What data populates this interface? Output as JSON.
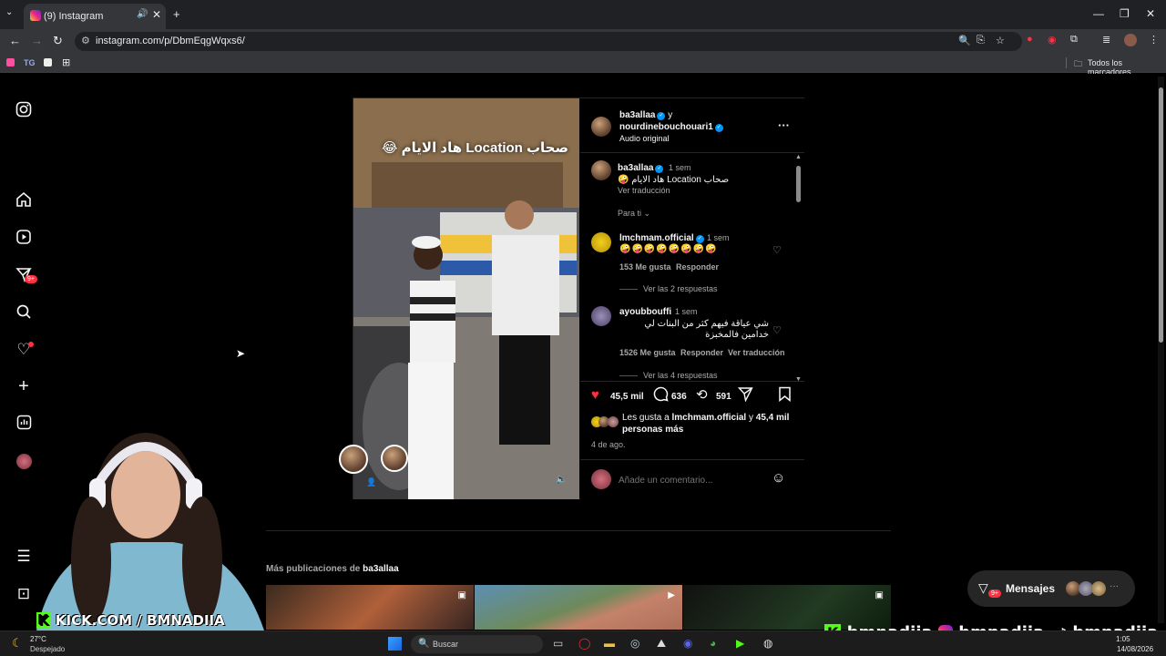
{
  "browser": {
    "tab_title": "(9) Instagram",
    "url": "instagram.com/p/DbmEqgWqxs6/",
    "bookmark_tg": "TG",
    "all_bookmarks": "Todos los marcadores"
  },
  "post": {
    "video_caption_overlay": "صحاب Location هاد الايام 😂",
    "header_user1": "ba3allaa",
    "header_and": "y",
    "header_user2": "nourdinebouchouari1",
    "header_audio": "Audio original",
    "caption_user": "ba3allaa",
    "caption_time": "1 sem",
    "caption_text": "صحاب Location هاد الايام 🤪",
    "see_translation": "Ver traducción",
    "for_you": "Para ti",
    "comments": [
      {
        "user": "lmchmam.official",
        "time": "1 sem",
        "text": "🤪🤪🤪🤪🤪🤪🤪🤪",
        "likes": "153 Me gusta",
        "reply": "Responder",
        "translate": "",
        "view_replies": "Ver las 2 respuestas"
      },
      {
        "user": "ayoubbouffi",
        "time": "1 sem",
        "text": "شي عياقة فيهم كثر من البنات لي خدامين فالمخبزة",
        "likes": "1526 Me gusta",
        "reply": "Responder",
        "translate": "Ver traducción",
        "view_replies": "Ver las 4 respuestas"
      }
    ],
    "likes_count": "45,5 mil",
    "comments_count": "636",
    "reposts_count": "591",
    "liked_by_prefix": "Les gusta a",
    "liked_by_user": "lmchmam.official",
    "liked_by_and": "y",
    "liked_by_rest": "45,4 mil personas más",
    "date": "4 de ago.",
    "comment_placeholder": "Añade un comentario..."
  },
  "more": {
    "title_prefix": "Más publicaciones de",
    "title_user": "ba3allaa"
  },
  "messages": {
    "label": "Mensajes",
    "badge": "9+"
  },
  "nav": {
    "notif_badge": "9+"
  },
  "stream": {
    "kick_overlay": "KICK.COM / BMNADIIA",
    "handle_kick": "bmnadiia",
    "handle_ig": "bmnadiia_",
    "handle_tiktok": "bmnadiia"
  },
  "taskbar": {
    "weather_temp": "27°C",
    "weather_desc": "Despejado",
    "search": "Buscar",
    "time": "1:05",
    "date": "14/08/2026"
  },
  "colors": {
    "accent_blue": "#0095f6",
    "like_red": "#ff3040",
    "background": "#000000"
  }
}
